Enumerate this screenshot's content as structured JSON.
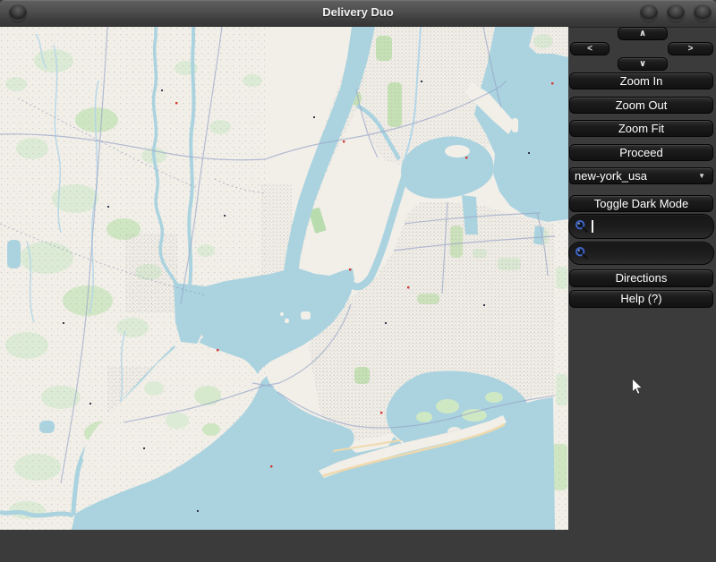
{
  "window": {
    "title": "Delivery Duo",
    "titlebar_left_buttons": [
      "window-menu-button"
    ],
    "titlebar_right_buttons": [
      "minimize-button",
      "maximize-button",
      "close-button"
    ]
  },
  "sidebar": {
    "pan_up": "∧",
    "pan_down": "∨",
    "pan_left": "<",
    "pan_right": ">",
    "zoom_in": "Zoom In",
    "zoom_out": "Zoom Out",
    "zoom_fit": "Zoom Fit",
    "proceed": "Proceed",
    "map_dropdown": {
      "value": "new-york_usa",
      "caret": "▼"
    },
    "toggle_dark_mode": "Toggle Dark Mode",
    "search_top": {
      "value": ""
    },
    "search_bottom": {
      "value": ""
    },
    "directions": "Directions",
    "help": "Help (?)"
  },
  "map": {
    "description": "OpenStreetMap raster view of the New York City metropolitan area"
  },
  "colors": {
    "window_bg": "#3b3b3b",
    "titlebar_top": "#606060",
    "titlebar_bottom": "#353535",
    "button_bg": "#1a1a1a",
    "button_text": "#ffffff",
    "map_land": "#f2efe9",
    "map_water": "#aad3df",
    "map_green": "#cde5bc",
    "search_icon_ring": "#4a6fd0"
  }
}
